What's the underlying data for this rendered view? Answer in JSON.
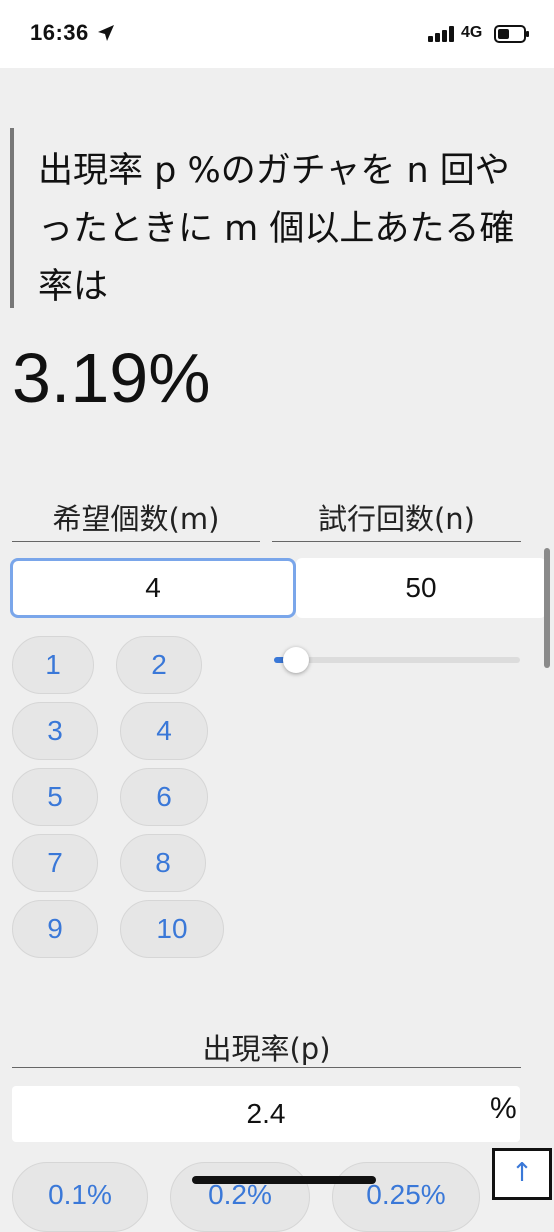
{
  "status_bar": {
    "time": "16:36",
    "network": "4G",
    "icons": [
      "location-arrow-icon",
      "cellular-signal-icon",
      "battery-icon"
    ]
  },
  "question": {
    "text": "出現率 p %のガチャを n 回やったときに m 個以上あたる確率は"
  },
  "result": {
    "value": "3.19%"
  },
  "desired_count": {
    "label": "希望個数(m)",
    "value": "4",
    "quick_buttons": [
      "1",
      "2",
      "3",
      "4",
      "5",
      "6",
      "7",
      "8",
      "9",
      "10"
    ]
  },
  "trial_count": {
    "label": "試行回数(n)",
    "value": "50",
    "slider_fraction": 0.09
  },
  "appearance_rate": {
    "label": "出現率(p)",
    "value": "2.4",
    "unit": "%",
    "preset_buttons": [
      "0.1%",
      "0.2%",
      "0.25%"
    ]
  },
  "scroll_top_button": {
    "label": "↑"
  },
  "colors": {
    "accent": "#3a78d8",
    "focus_border": "#7aa6ea",
    "background": "#efefef"
  }
}
